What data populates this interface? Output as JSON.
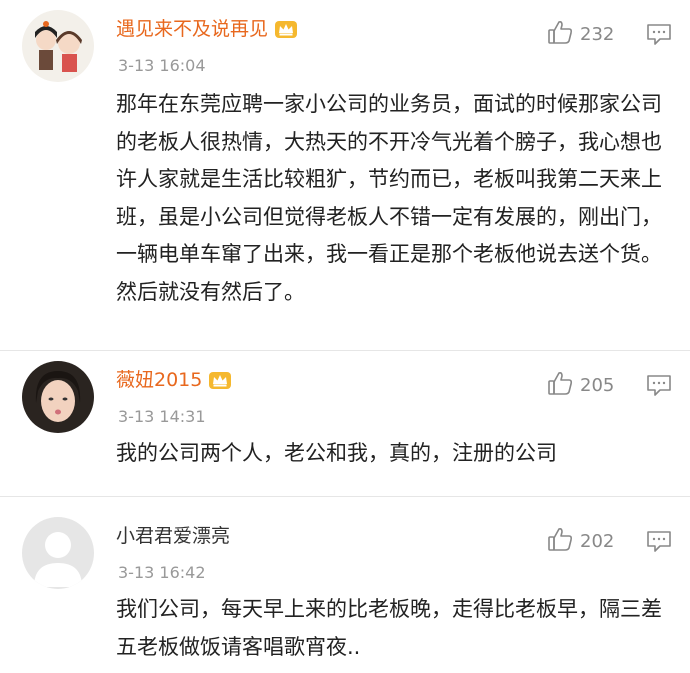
{
  "comments": [
    {
      "username": "遇见来不及说再见",
      "timestamp": "3-13 16:04",
      "likes": "232",
      "text": "那年在东莞应聘一家小公司的业务员，面试的时候那家公司的老板人很热情，大热天的不开冷气光着个膀子，我心想也许人家就是生活比较粗犷，节约而已，老板叫我第二天来上班，虽是小公司但觉得老板人不错一定有发展的，刚出门，一辆电单车窜了出来，我一看正是那个老板他说去送个货。然后就没有然后了。",
      "vip": true
    },
    {
      "username": "薇妞2015",
      "timestamp": "3-13 14:31",
      "likes": "205",
      "text": "我的公司两个人，老公和我，真的，注册的公司",
      "vip": true
    },
    {
      "username": "小君君爱漂亮",
      "timestamp": "3-13 16:42",
      "likes": "202",
      "text": "我们公司，每天早上来的比老板晚，走得比老板早，隔三差五老板做饭请客唱歌宵夜..",
      "vip": false
    }
  ],
  "icons": {
    "like": "thumbs-up-icon",
    "reply": "comment-bubble-icon",
    "vip": "crown-icon"
  },
  "colors": {
    "vip_username": "#e8681e",
    "normal_username": "#333333",
    "meta": "#999999"
  }
}
